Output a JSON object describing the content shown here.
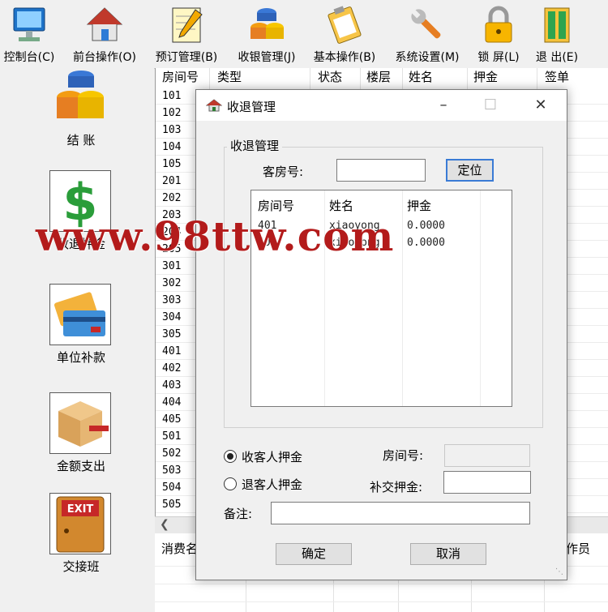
{
  "toolbar": {
    "items": [
      {
        "label": "控制台(C)",
        "icon": "monitor-icon"
      },
      {
        "label": "前台操作(O)",
        "icon": "house-icon"
      },
      {
        "label": "预订管理(B)",
        "icon": "notepad-pencil-icon"
      },
      {
        "label": "收银管理(J)",
        "icon": "coin-stack-icon"
      },
      {
        "label": "基本操作(B)",
        "icon": "clipboard-icon"
      },
      {
        "label": "系统设置(M)",
        "icon": "wrench-icon"
      },
      {
        "label": "锁 屏(L)",
        "icon": "padlock-icon"
      },
      {
        "label": "退 出(E)",
        "icon": "exit-door-icon"
      }
    ]
  },
  "sidebar": {
    "items": [
      {
        "label": "结 账",
        "icon": "coins-icon"
      },
      {
        "label": "收退押金",
        "icon": "dollar-icon"
      },
      {
        "label": "单位补款",
        "icon": "credit-card-icon"
      },
      {
        "label": "金额支出",
        "icon": "box-icon"
      },
      {
        "label": "交接班",
        "icon": "exit-sign-icon"
      }
    ]
  },
  "grid": {
    "headers": [
      "房间号",
      "类型",
      "状态",
      "楼层",
      "姓名",
      "押金",
      "签单"
    ],
    "rooms": [
      "101",
      "102",
      "103",
      "104",
      "105",
      "201",
      "202",
      "203",
      "204",
      "205",
      "301",
      "302",
      "303",
      "304",
      "305",
      "401",
      "402",
      "403",
      "404",
      "405",
      "501",
      "502",
      "503",
      "504",
      "505"
    ]
  },
  "bottom": {
    "left_label": "消费名",
    "right_label": "操作员"
  },
  "dialog": {
    "title": "收退管理",
    "group_label": "收退管理",
    "room_label": "客房号:",
    "room_value": "",
    "locate_button": "定位",
    "list_headers": [
      "房间号",
      "姓名",
      "押金"
    ],
    "list_rows": [
      {
        "room": "401",
        "name": "xiaoyong",
        "deposit": "0.0000"
      },
      {
        "room": "401",
        "name": "xiaoyong",
        "deposit": "0.0000"
      }
    ],
    "radio_collect": "收客人押金",
    "radio_refund": "退客人押金",
    "selected_radio": "collect",
    "room_no_label": "房间号:",
    "supp_label": "补交押金:",
    "remark_label": "备注:",
    "ok_button": "确定",
    "cancel_button": "取消"
  },
  "watermark": "www.98ttw.com",
  "colors": {
    "accent": "#3a7bd5",
    "watermark": "#b31b1b",
    "window_bg": "#f0f0f0"
  }
}
